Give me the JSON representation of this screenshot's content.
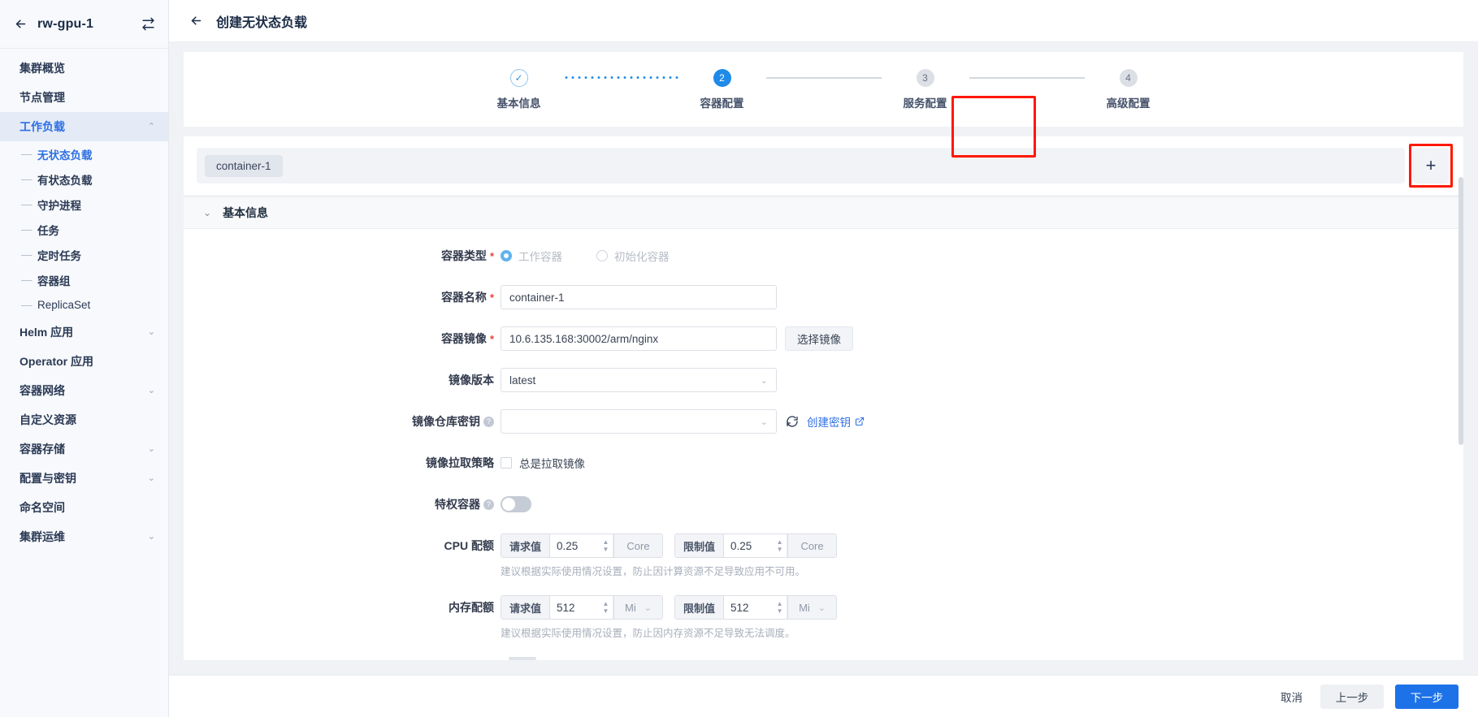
{
  "sidebar": {
    "cluster_name": "rw-gpu-1",
    "back_icon": "arrow-left-icon",
    "switch_icon": "switch-cluster-icon",
    "items": [
      {
        "label": "集群概览",
        "type": "item",
        "state": "normal",
        "caret": ""
      },
      {
        "label": "节点管理",
        "type": "item",
        "state": "normal",
        "caret": ""
      },
      {
        "label": "工作负载",
        "type": "item",
        "state": "active",
        "caret": "⌃"
      },
      {
        "label": "无状态负载",
        "type": "sub",
        "state": "selected"
      },
      {
        "label": "有状态负载",
        "type": "sub",
        "state": "normal"
      },
      {
        "label": "守护进程",
        "type": "sub",
        "state": "normal"
      },
      {
        "label": "任务",
        "type": "sub",
        "state": "normal"
      },
      {
        "label": "定时任务",
        "type": "sub",
        "state": "normal"
      },
      {
        "label": "容器组",
        "type": "sub",
        "state": "normal"
      },
      {
        "label": "ReplicaSet",
        "type": "sub",
        "state": "normal"
      },
      {
        "label": "Helm 应用",
        "type": "item",
        "state": "normal",
        "caret": "⌄"
      },
      {
        "label": "Operator 应用",
        "type": "item",
        "state": "normal",
        "caret": ""
      },
      {
        "label": "容器网络",
        "type": "item",
        "state": "normal",
        "caret": "⌄"
      },
      {
        "label": "自定义资源",
        "type": "item",
        "state": "normal",
        "caret": ""
      },
      {
        "label": "容器存储",
        "type": "item",
        "state": "normal",
        "caret": "⌄"
      },
      {
        "label": "配置与密钥",
        "type": "item",
        "state": "normal",
        "caret": "⌄"
      },
      {
        "label": "命名空间",
        "type": "item",
        "state": "normal",
        "caret": ""
      },
      {
        "label": "集群运维",
        "type": "item",
        "state": "normal",
        "caret": "⌄"
      }
    ]
  },
  "topbar": {
    "back_icon": "arrow-left-icon",
    "title": "创建无状态负载"
  },
  "steps": {
    "items": [
      {
        "num": "✓",
        "label": "基本信息",
        "state": "done"
      },
      {
        "num": "2",
        "label": "容器配置",
        "state": "current"
      },
      {
        "num": "3",
        "label": "服务配置",
        "state": "todo"
      },
      {
        "num": "4",
        "label": "高级配置",
        "state": "todo"
      }
    ],
    "highlight_color": "#ff1800"
  },
  "container_tabs": {
    "tabs": [
      {
        "label": "container-1",
        "active": true
      }
    ],
    "add_label": "+",
    "add_icon": "plus-icon",
    "highlight_color": "#ff1800"
  },
  "section": {
    "title": "基本信息",
    "collapse_icon": "chevron-down-icon"
  },
  "form": {
    "container_type": {
      "label": "容器类型",
      "required": true,
      "options": [
        {
          "label": "工作容器",
          "checked": true
        },
        {
          "label": "初始化容器",
          "checked": false
        }
      ]
    },
    "container_name": {
      "label": "容器名称",
      "required": true,
      "value": "container-1",
      "placeholder": ""
    },
    "container_image": {
      "label": "容器镜像",
      "required": true,
      "value": "10.6.135.168:30002/arm/nginx",
      "placeholder": "",
      "button_label": "选择镜像"
    },
    "image_version": {
      "label": "镜像版本",
      "value": "latest",
      "chevron": "chevron-down-icon"
    },
    "registry_secret": {
      "label": "镜像仓库密钥",
      "help_icon": "question-mark-icon",
      "value": "",
      "placeholder": "",
      "refresh_icon": "refresh-icon",
      "link_label": "创建密钥",
      "link_external_icon": "external-link-icon"
    },
    "pull_policy": {
      "label": "镜像拉取策略",
      "checkbox_label": "总是拉取镜像",
      "checked": false
    },
    "privileged": {
      "label": "特权容器",
      "help_icon": "question-mark-icon",
      "enabled": false
    },
    "cpu_quota": {
      "label": "CPU 配额",
      "request_prefix": "请求值",
      "request_value": "0.25",
      "request_unit": "Core",
      "limit_prefix": "限制值",
      "limit_value": "0.25",
      "limit_unit": "Core",
      "hint": "建议根据实际使用情况设置，防止因计算资源不足导致应用不可用。"
    },
    "memory_quota": {
      "label": "内存配额",
      "request_prefix": "请求值",
      "request_value": "512",
      "request_unit": "Mi",
      "limit_prefix": "限制值",
      "limit_value": "512",
      "limit_unit": "Mi",
      "hint": "建议根据实际使用情况设置，防止因内存资源不足导致无法调度。"
    }
  },
  "footer": {
    "cancel": "取消",
    "prev": "上一步",
    "next": "下一步",
    "primary_color": "#1d72e8"
  }
}
